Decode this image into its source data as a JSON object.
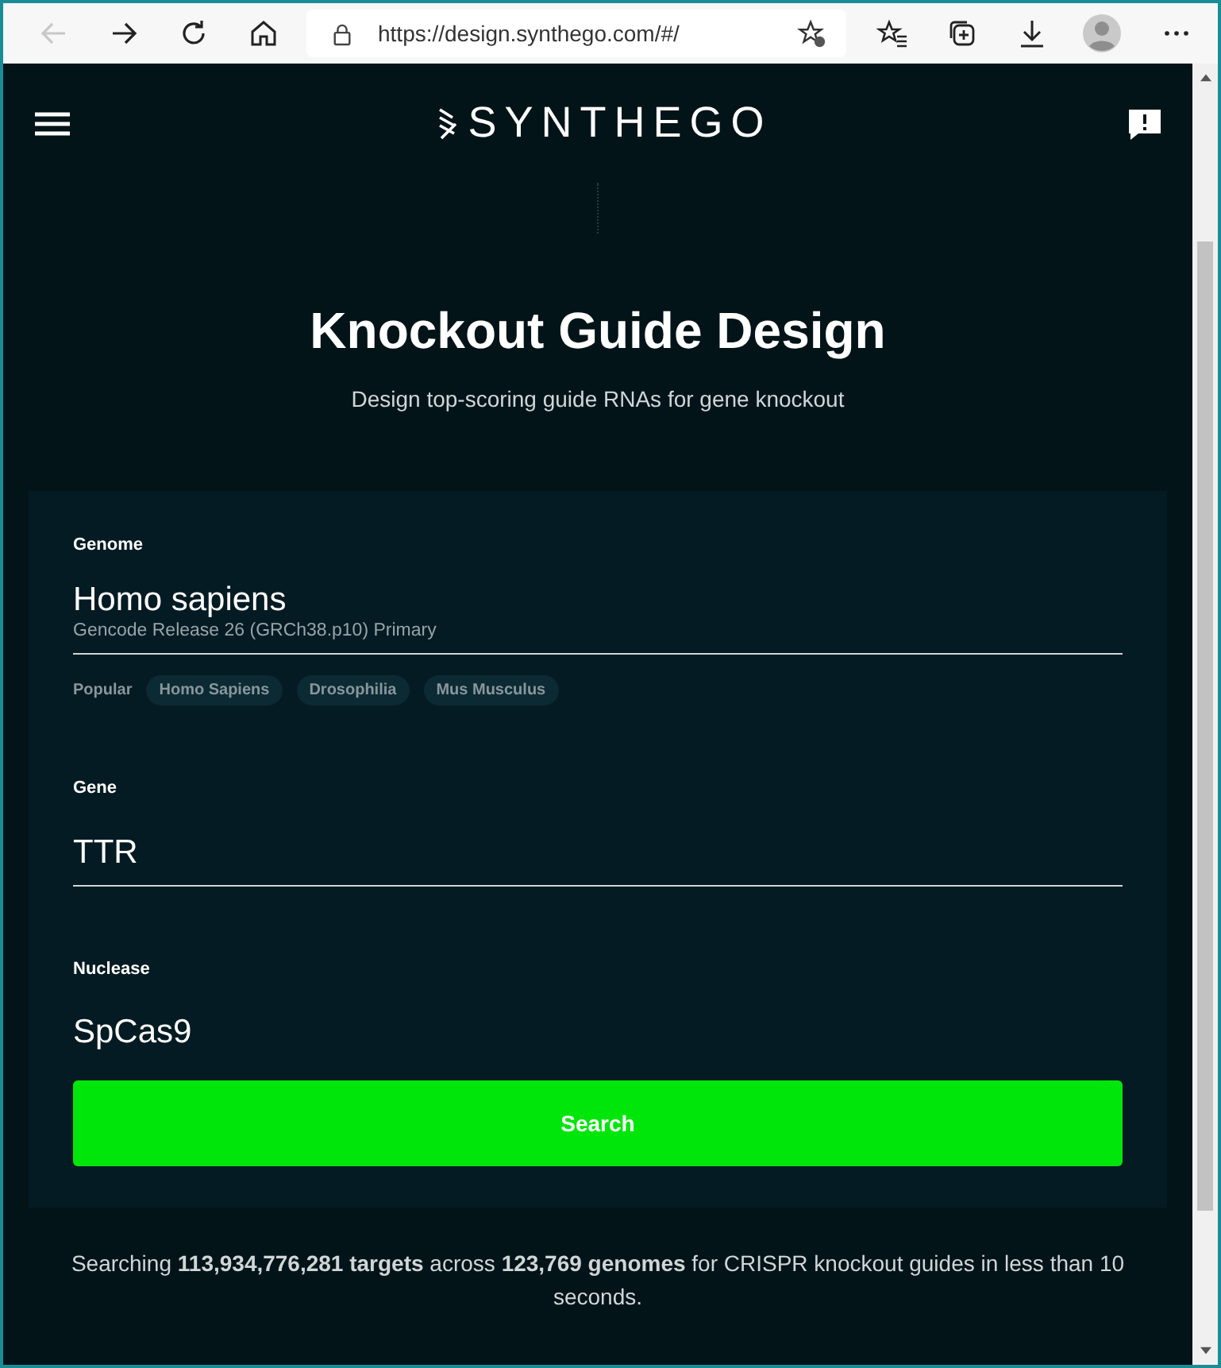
{
  "browser": {
    "url": "https://design.synthego.com/#/"
  },
  "header": {
    "logo": "SYNTHEGO"
  },
  "title": "Knockout Guide Design",
  "subtitle": "Design top-scoring guide RNAs for gene knockout",
  "fields": [
    {
      "label": "Genome",
      "value": "Homo sapiens",
      "detail": "Gencode Release 26 (GRCh38.p10) Primary",
      "popular": {
        "label": "Popular",
        "chips": [
          "Homo Sapiens",
          "Drosophilia",
          "Mus Musculus"
        ]
      }
    },
    {
      "label": "Gene",
      "value": "TTR"
    }
  ],
  "nuclease": {
    "label": "Nuclease",
    "value": "SpCas9"
  },
  "search_button": "Search",
  "footer": "Searching **113,934,776,281 targets** across **123,769 genomes** for CRISPR knockout guides in less than 10 seconds."
}
